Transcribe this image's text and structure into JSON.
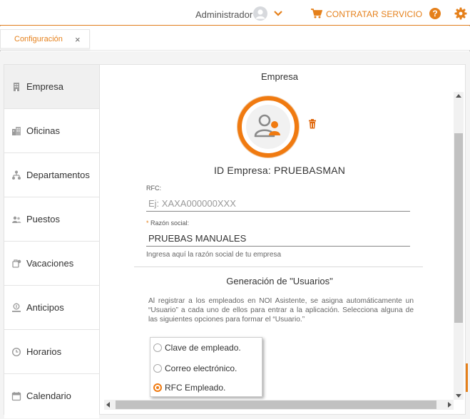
{
  "header": {
    "user_name": "Administrador",
    "service_button": "CONTRATAR SERVICIO",
    "help_symbol": "?",
    "accent_color": "#e5801b",
    "icons": [
      "user-avatar-icon",
      "chevron-down-icon",
      "cart-icon",
      "help-icon",
      "gear-icon"
    ]
  },
  "tabs": [
    {
      "label": "Configuración",
      "close": "×"
    }
  ],
  "sidebar": {
    "items": [
      {
        "label": "Empresa",
        "icon": "building-icon",
        "active": true
      },
      {
        "label": "Oficinas",
        "icon": "office-icon",
        "active": false
      },
      {
        "label": "Departamentos",
        "icon": "org-chart-icon",
        "active": false
      },
      {
        "label": "Puestos",
        "icon": "users-icon",
        "active": false
      },
      {
        "label": "Vacaciones",
        "icon": "vacation-icon",
        "active": false
      },
      {
        "label": "Anticipos",
        "icon": "money-hand-icon",
        "active": false
      },
      {
        "label": "Horarios",
        "icon": "clock-icon",
        "active": false
      },
      {
        "label": "Calendario",
        "icon": "calendar-icon",
        "active": false
      }
    ]
  },
  "form": {
    "section_title": "Empresa",
    "company_id": "ID Empresa: PRUEBASMAN",
    "rfc_label": "RFC:",
    "rfc_placeholder": "Ej: XAXA000000XXX",
    "rfc_value": "",
    "razon_required": "*",
    "razon_label": "Razón social:",
    "razon_value": "PRUEBAS MANUALES",
    "razon_helper": "Ingresa aquí la razón social de tu empresa",
    "users_title": "Generación de \"Usuarios\"",
    "users_description": "Al registrar a los empleados en NOI Asistente, se asigna automáticamente un “Usuario” a cada uno de ellos para entrar a la aplicación. Selecciona alguna de las siguientes opciones para formar el “Usuario.”",
    "options": [
      {
        "label": "Clave de empleado.",
        "checked": false
      },
      {
        "label": "Correo electrónico.",
        "checked": false
      },
      {
        "label": "RFC Empleado.",
        "checked": true
      }
    ]
  }
}
